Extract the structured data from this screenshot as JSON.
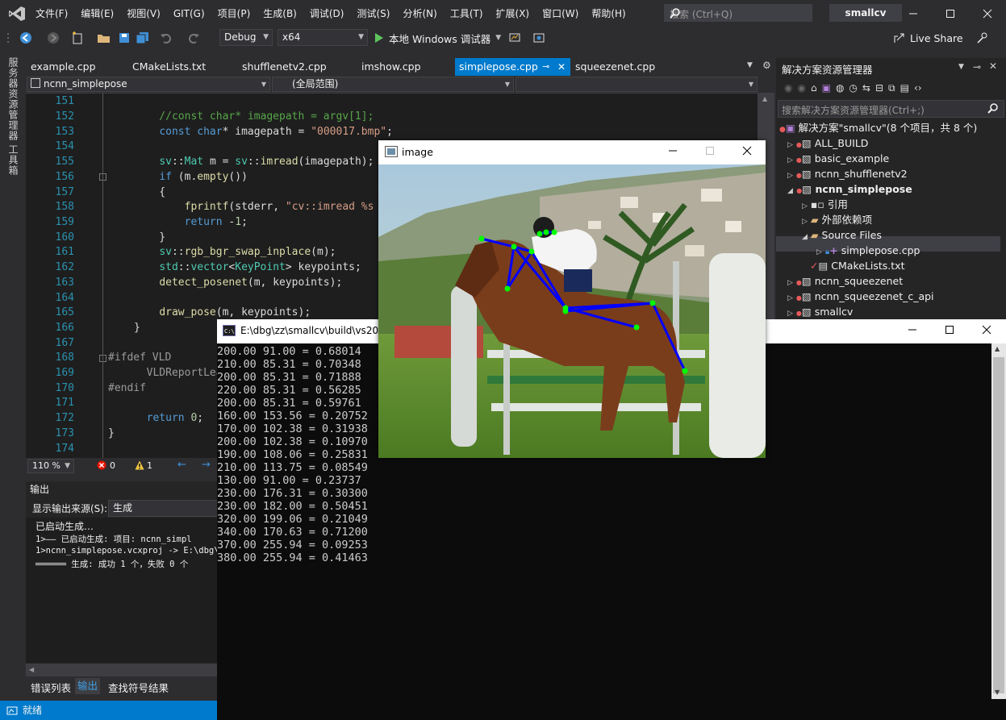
{
  "menu": {
    "items": [
      "文件(F)",
      "编辑(E)",
      "视图(V)",
      "GIT(G)",
      "项目(P)",
      "生成(B)",
      "调试(D)",
      "测试(S)",
      "分析(N)",
      "工具(T)",
      "扩展(X)",
      "窗口(W)",
      "帮助(H)"
    ],
    "search_placeholder": "搜索 (Ctrl+Q)",
    "solution_badge": "smallcv"
  },
  "toolbar": {
    "config": "Debug",
    "platform": "x64",
    "run_label": "本地 Windows 调试器",
    "live_share": "Live Share"
  },
  "left_strip": {
    "tab1": "服务器资源管理器",
    "tab2": "工具箱"
  },
  "doc_tabs": [
    {
      "label": "example.cpp"
    },
    {
      "label": "CMakeLists.txt"
    },
    {
      "label": "shufflenetv2.cpp"
    },
    {
      "label": "imshow.cpp"
    },
    {
      "label": "simplepose.cpp"
    },
    {
      "label": "squeezenet.cpp"
    }
  ],
  "nav": {
    "project": "ncnn_simplepose",
    "scope": "(全局范围)"
  },
  "editor": {
    "line_numbers": [
      "151",
      "152",
      "153",
      "154",
      "155",
      "156",
      "157",
      "158",
      "159",
      "160",
      "161",
      "162",
      "163",
      "164",
      "165",
      "166",
      "167",
      "168",
      "169",
      "170",
      "171",
      "172",
      "173",
      "174"
    ],
    "zoom": "110 %",
    "errors": "0",
    "warnings": "1"
  },
  "output": {
    "title": "输出",
    "source_label": "显示输出来源(S):",
    "source_value": "生成",
    "lines": [
      "已启动生成…",
      "1>—— 已启动生成: 项目: ncnn_simpl",
      "1>ncnn_simplepose.vcxproj -> E:\\dbg\\z",
      "══════ 生成: 成功 1 个，失败 0 个"
    ],
    "tabs": [
      "错误列表",
      "输出",
      "查找符号结果"
    ]
  },
  "status": {
    "text": "就绪"
  },
  "solution_explorer": {
    "title": "解决方案资源管理器",
    "search_placeholder": "搜索解决方案资源管理器(Ctrl+;)",
    "rows": [
      "解决方案\"smallcv\"(8 个项目，共 8 个)",
      "ALL_BUILD",
      "basic_example",
      "ncnn_shufflenetv2",
      "ncnn_simplepose",
      "引用",
      "外部依赖项",
      "Source Files",
      "simplepose.cpp",
      "CMakeLists.txt",
      "ncnn_squeezenet",
      "ncnn_squeezenet_c_api",
      "smallcv"
    ]
  },
  "image_window": {
    "title": "image"
  },
  "console": {
    "title": "E:\\dbg\\zz\\smallcv\\build\\vs20",
    "lines": [
      "200.00 91.00 = 0.68014",
      "210.00 85.31 = 0.70348",
      "200.00 85.31 = 0.71888",
      "220.00 85.31 = 0.56285",
      "200.00 85.31 = 0.59761",
      "160.00 153.56 = 0.20752",
      "170.00 102.38 = 0.31938",
      "200.00 102.38 = 0.10970",
      "190.00 108.06 = 0.25831",
      "210.00 113.75 = 0.08549",
      "130.00 91.00 = 0.23737",
      "230.00 176.31 = 0.30300",
      "230.00 182.00 = 0.50451",
      "320.00 199.06 = 0.21049",
      "340.00 170.63 = 0.71200",
      "370.00 255.94 = 0.09253",
      "380.00 255.94 = 0.41463"
    ]
  },
  "colors": {
    "accent": "#007acc",
    "background": "#2d2d30",
    "editor_bg": "#1e1e1e",
    "console_bg": "#0c0c0c",
    "pose_line": "#0000ff",
    "keypoint": "#00ff00"
  }
}
